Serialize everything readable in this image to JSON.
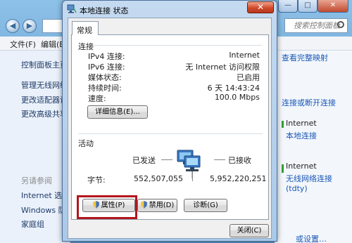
{
  "background_window": {
    "menu": [
      "文件(F)",
      "编辑(E)"
    ],
    "search_placeholder": "搜索控制面板",
    "left_panel": {
      "items": [
        "控制面板主页",
        "管理无线网络",
        "更改适配器设置",
        "更改高级共享设置"
      ],
      "see_also_title": "另请参阅",
      "see_also": [
        "Internet 选项",
        "Windows 防火墙",
        "家庭组"
      ]
    },
    "right_panel": {
      "link_full_map": "查看完整映射",
      "link_connect": "连接或断开连接",
      "access_type_1": "Internet",
      "connection_1": "本地连接",
      "access_type_2": "Internet",
      "connection_2": "无线网络连接",
      "connection_2_ssid": "(tdty)",
      "bottom_text": "或设置…"
    }
  },
  "dialog": {
    "title": "本地连接 状态",
    "tab_general": "常规",
    "connection": {
      "section_title": "连接",
      "rows": [
        {
          "label": "IPv4 连接:",
          "value": "Internet"
        },
        {
          "label": "IPv6 连接:",
          "value": "无 Internet 访问权限"
        },
        {
          "label": "媒体状态:",
          "value": "已启用"
        },
        {
          "label": "持续时间:",
          "value": "6 天 14:43:24"
        },
        {
          "label": "速度:",
          "value": "100.0 Mbps"
        }
      ],
      "details_button": "详细信息(E)..."
    },
    "activity": {
      "section_title": "活动",
      "sent_label": "已发送",
      "received_label": "已接收",
      "bytes_label": "字节:",
      "bytes_sent": "552,507,055",
      "bytes_received": "5,952,220,251"
    },
    "buttons": {
      "properties": "属性(P)",
      "disable": "禁用(D)",
      "diagnose": "诊断(G)",
      "close": "关闭(C)"
    }
  },
  "colors": {
    "highlight": "#b3161c",
    "link": "#1a57b5"
  }
}
